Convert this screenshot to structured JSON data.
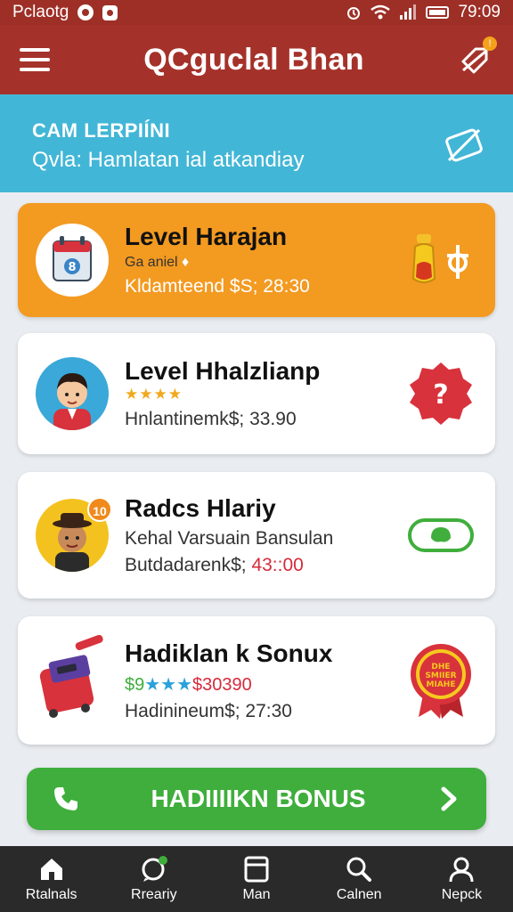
{
  "status_bar": {
    "left_text": "Pclaotg",
    "time": "79:09"
  },
  "app_bar": {
    "title": "QCguclal Bhan"
  },
  "banner": {
    "title": "CAM LERPIÍNI",
    "subtitle": "Qvla: Hamlatan ial atkandiay"
  },
  "cards": [
    {
      "title": "Level Harajan",
      "line1": "Ga aniel",
      "line2": "Kldamteend $S; 28:30",
      "background": "#f39a21"
    },
    {
      "title": "Level Hhalzlianp",
      "stars": "★★★★",
      "line2": "Hnlantinemk$; 33.90",
      "badge": "?"
    },
    {
      "title": "Radcs Hlariy",
      "avatar_badge": "10",
      "line1": "Kehal Varsuain Bansulan",
      "line2_prefix": "Butdadarenk$; ",
      "line2_value": "43::00"
    },
    {
      "title": "Hadiklan k Sonux",
      "line1_prefix": "$9",
      "line1_stars": "★★★",
      "line1_value": "$30390",
      "line2": "Hadinineum$; 27:30",
      "ribbon_text": "DHE SMIIER MIAHE"
    }
  ],
  "bonus_button": {
    "label": "HADIIIIKN BONUS"
  },
  "bottom_nav": {
    "items": [
      {
        "label": "Rtalnals",
        "icon": "home-icon"
      },
      {
        "label": "Rreariy",
        "icon": "chat-icon"
      },
      {
        "label": "Man",
        "icon": "window-icon"
      },
      {
        "label": "Calnen",
        "icon": "search-icon"
      },
      {
        "label": "Nepck",
        "icon": "profile-icon"
      }
    ]
  },
  "colors": {
    "app_bar": "#a5322a",
    "banner": "#42b6d6",
    "accent_orange": "#f39a21",
    "bonus_green": "#3fae3c",
    "nav_bg": "#2a2a2a"
  }
}
